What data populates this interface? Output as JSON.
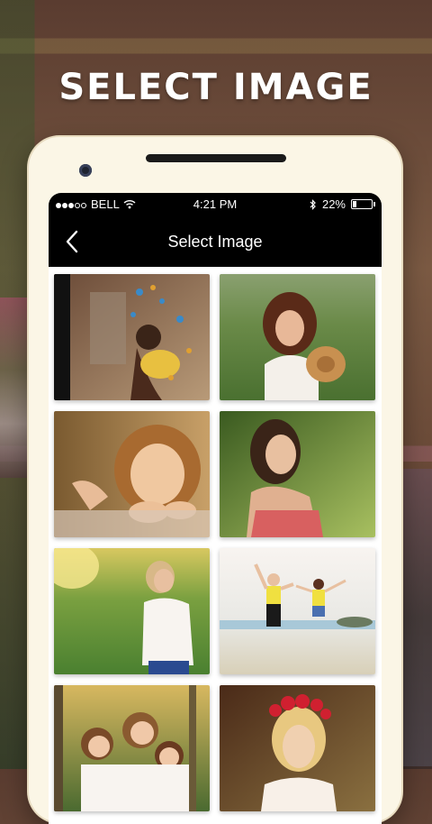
{
  "headline": "SELECT IMAGE",
  "status_bar": {
    "carrier": "BELL",
    "time": "4:21 PM",
    "battery": "22%",
    "battery_level": 0.22,
    "signal_icon": "signal-dots-icon",
    "wifi_icon": "wifi-icon",
    "bluetooth_icon": "bluetooth-icon"
  },
  "nav": {
    "title": "Select Image",
    "back_icon": "chevron-left-icon"
  },
  "gallery": {
    "items": [
      {
        "subject": "girl with butterflies"
      },
      {
        "subject": "girl holding straw hat"
      },
      {
        "subject": "smiling girl resting chin"
      },
      {
        "subject": "woman smiling outdoors"
      },
      {
        "subject": "woman in white top in park"
      },
      {
        "subject": "couple jumping on beach"
      },
      {
        "subject": "three girls in forest"
      },
      {
        "subject": "woman with flower crown"
      }
    ]
  },
  "colors": {
    "bar": "#000000",
    "phone_body": "#fbf6e6"
  }
}
